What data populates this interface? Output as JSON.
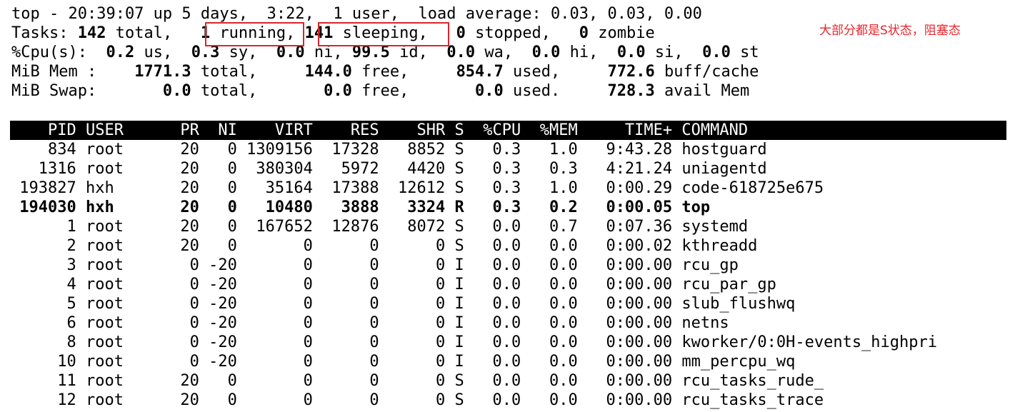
{
  "summary": {
    "line1": "top - 20:39:07 up 5 days,  3:22,  1 user,  load average: 0.03, 0.03, 0.00",
    "tasks": {
      "prefix": "Tasks: ",
      "total": "142",
      "total_label": " total,   ",
      "running": "1",
      "running_label": " running",
      "sep": ", ",
      "sleeping": "141",
      "sleeping_label": " sleeping",
      "sep2": ",   ",
      "stopped": "0",
      "stopped_label": " stopped,   ",
      "zombie": "0",
      "zombie_label": " zombie"
    },
    "cpu": {
      "prefix": "%Cpu(s):  ",
      "us": "0.2",
      "us_label": " us,  ",
      "sy": "0.3",
      "sy_label": " sy,  ",
      "ni": "0.0",
      "ni_label": " ni, ",
      "id": "99.5",
      "id_label": " id,  ",
      "wa": "0.0",
      "wa_label": " wa,  ",
      "hi": "0.0",
      "hi_label": " hi,  ",
      "si": "0.0",
      "si_label": " si,  ",
      "st": "0.0",
      "st_label": " st"
    },
    "mem": {
      "prefix": "MiB Mem :    ",
      "total": "1771.3",
      "total_label": " total,     ",
      "free": "144.0",
      "free_label": " free,     ",
      "used": "854.7",
      "used_label": " used,     ",
      "buff": "772.6",
      "buff_label": " buff/cache"
    },
    "swap": {
      "prefix": "MiB Swap:       ",
      "total": "0.0",
      "total_label": " total,       ",
      "free": "0.0",
      "free_label": " free,       ",
      "used": "0.0",
      "used_label": " used.     ",
      "avail": "728.3",
      "avail_label": " avail Mem"
    }
  },
  "annotation": "大部分都是S状态，阻塞态",
  "annotation_color": "#e8262b",
  "table": {
    "header": "    PID USER      PR  NI    VIRT    RES    SHR S  %CPU  %MEM     TIME+ COMMAND",
    "rows": [
      "    834 root      20   0 1309156  17328   8852 S   0.3   1.0   9:43.28 hostguard",
      "   1316 root      20   0  380304   5972   4420 S   0.3   0.3   4:21.24 uniagentd",
      " 193827 hxh       20   0   35164  17388  12612 S   0.3   1.0   0:00.29 code-618725e675",
      " 194030 hxh       20   0   10480   3888   3324 R   0.3   0.2   0:00.05 top",
      "      1 root      20   0  167652  12876   8072 S   0.0   0.7   0:07.36 systemd",
      "      2 root      20   0       0      0      0 S   0.0   0.0   0:00.02 kthreadd",
      "      3 root       0 -20       0      0      0 I   0.0   0.0   0:00.00 rcu_gp",
      "      4 root       0 -20       0      0      0 I   0.0   0.0   0:00.00 rcu_par_gp",
      "      5 root       0 -20       0      0      0 I   0.0   0.0   0:00.00 slub_flushwq",
      "      6 root       0 -20       0      0      0 I   0.0   0.0   0:00.00 netns",
      "      8 root       0 -20       0      0      0 I   0.0   0.0   0:00.00 kworker/0:0H-events_highpri",
      "     10 root       0 -20       0      0      0 I   0.0   0.0   0:00.00 mm_percpu_wq",
      "     11 root      20   0       0      0      0 S   0.0   0.0   0:00.00 rcu_tasks_rude_",
      "     12 root      20   0       0      0      0 S   0.0   0.0   0:00.00 rcu_tasks_trace"
    ]
  }
}
